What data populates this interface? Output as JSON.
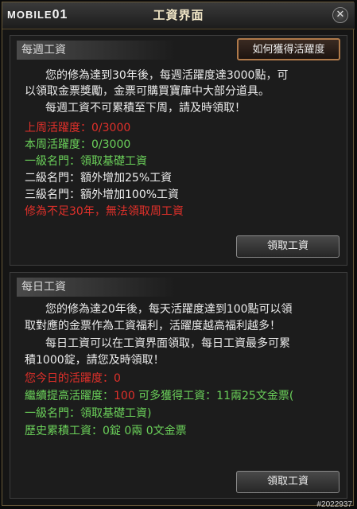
{
  "window": {
    "title": "工資界面",
    "close_label": "✕",
    "logo_text": "MOBILE",
    "logo_num": "01"
  },
  "weekly": {
    "section_title": "每週工資",
    "activity_button": "如何獲得活躍度",
    "desc_1": "您的修為達到30年後，每週活躍度達3000點，可",
    "desc_2": "以領取金票獎勵，金票可購買寶庫中大部分道具。",
    "desc_3": "每週工資不可累積至下周，請及時領取！",
    "last_week": "上周活躍度：0/3000",
    "this_week": "本周活躍度：0/3000",
    "rank1": "一級名門：領取基礎工資",
    "rank2": "二級名門：額外增加25%工資",
    "rank3": "三級名門：額外增加100%工資",
    "warning": "修為不足30年，無法領取周工資",
    "claim_button": "領取工資"
  },
  "daily": {
    "section_title": "每日工資",
    "desc_1": "您的修為達20年後，每天活躍度達到100點可以領",
    "desc_2": "取對應的金票作為工資福利，活躍度越高福利越多！",
    "desc_3": "每日工資可以在工資界面領取，每日工資最多可累",
    "desc_4": "積1000錠，請您及時領取！",
    "today_activity": "您今日的活躍度：0",
    "continue_prefix": "繼續提高活躍度：",
    "continue_value": "100",
    "continue_suffix": " 可多獲得工資：11兩25文金票(",
    "rank_note": "一級名門：領取基礎工資)",
    "history": "歷史累積工資：0錠 0兩 0文金票",
    "claim_button": "領取工資"
  },
  "watermark": "#2022937",
  "colors": {
    "red": "#e0302a",
    "green": "#6bd15a",
    "accent_border": "#b07a4a"
  }
}
